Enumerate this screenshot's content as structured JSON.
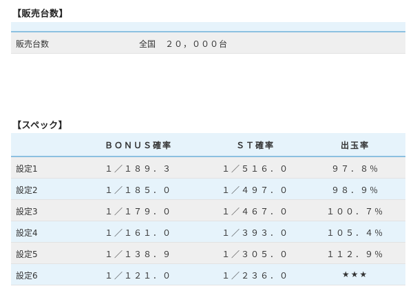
{
  "sales_section": {
    "title": "【販売台数】",
    "row_label": "販売台数",
    "region": "全国",
    "count": "２０，０００台"
  },
  "spec_section": {
    "title": "【スペック】",
    "headers": [
      "",
      "ＢＯＮＵＳ確率",
      "ＳＴ確率",
      "出玉率"
    ],
    "rows": [
      {
        "setting": "設定1",
        "bonus": "１／１８９．３",
        "st": "１／５１６．０",
        "payout": "９７．８％"
      },
      {
        "setting": "設定2",
        "bonus": "１／１８５．０",
        "st": "１／４９７．０",
        "payout": "９８．９％"
      },
      {
        "setting": "設定3",
        "bonus": "１／１７９．０",
        "st": "１／４６７．０",
        "payout": "１００．７％"
      },
      {
        "setting": "設定4",
        "bonus": "１／１６１．０",
        "st": "１／３９３．０",
        "payout": "１０５．４％"
      },
      {
        "setting": "設定5",
        "bonus": "１／１３８．９",
        "st": "１／３０５．０",
        "payout": "１１２．９％"
      },
      {
        "setting": "設定6",
        "bonus": "１／１２１．０",
        "st": "１／２３６．０",
        "payout": "★★★"
      }
    ]
  }
}
